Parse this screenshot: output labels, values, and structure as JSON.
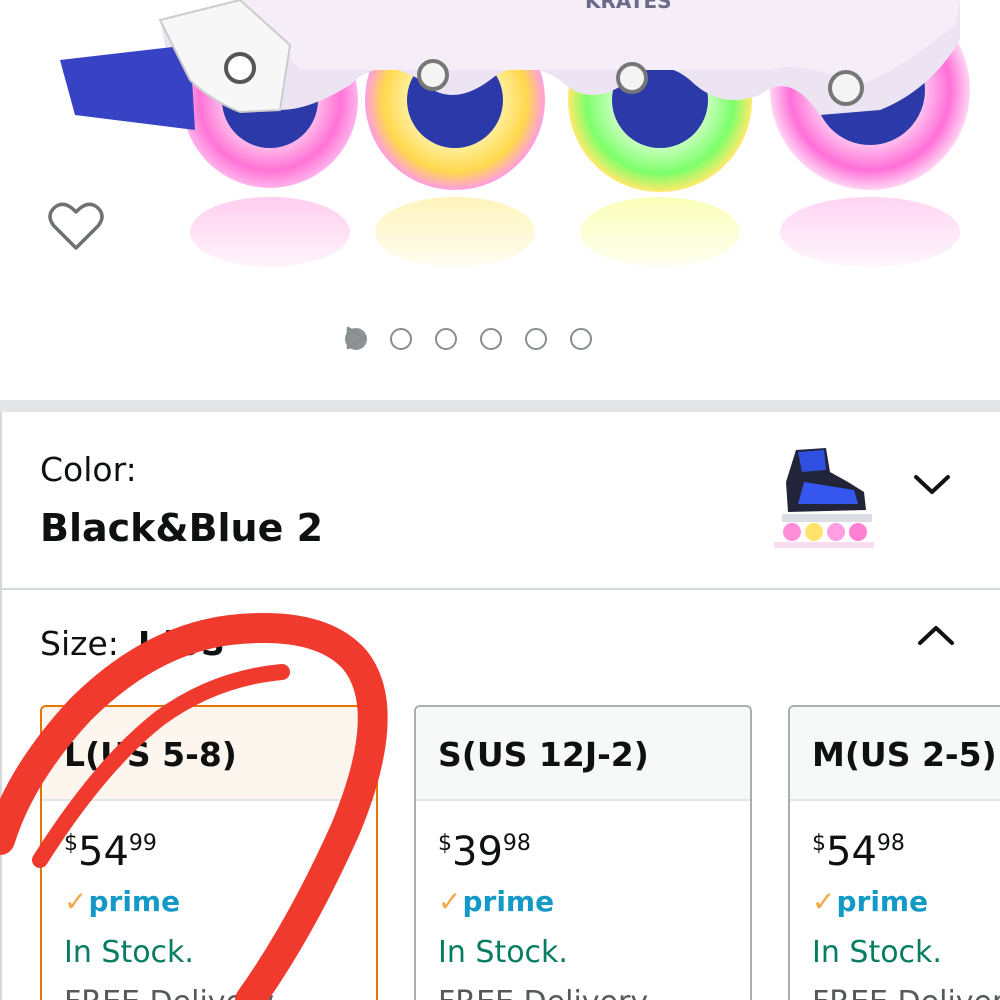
{
  "product_image": {
    "brand_text": "KRATES",
    "wishlist_icon": "heart-outline-icon",
    "carousel": {
      "total_images": 6,
      "active_index": 0,
      "next_icon": "play-triangle-icon"
    }
  },
  "color": {
    "label": "Color:",
    "value": "Black&Blue 2",
    "expand_icon": "chevron-down-icon"
  },
  "size": {
    "label": "Size:",
    "value": "L(US",
    "collapse_icon": "chevron-up-icon",
    "options": [
      {
        "name": "L(US 5-8)",
        "currency": "$",
        "dollars": "54",
        "cents": "99",
        "prime": "prime",
        "stock": "In Stock.",
        "delivery": "FREE Delivery",
        "selected": true
      },
      {
        "name": "S(US 12J-2)",
        "currency": "$",
        "dollars": "39",
        "cents": "98",
        "prime": "prime",
        "stock": "In Stock.",
        "delivery": "FREE Delivery",
        "selected": false
      },
      {
        "name": "M(US 2-5)",
        "currency": "$",
        "dollars": "54",
        "cents": "98",
        "prime": "prime",
        "stock": "In Stock.",
        "delivery": "FREE Delivery",
        "selected": false
      }
    ]
  },
  "colors": {
    "accent_orange": "#e77600",
    "prime_blue": "#1399c6",
    "prime_check": "#f3a847",
    "stock_green": "#067d62",
    "annotation_red": "#f03a2e"
  }
}
